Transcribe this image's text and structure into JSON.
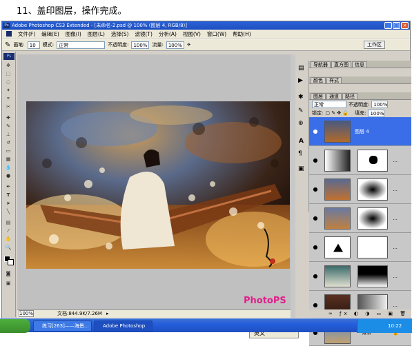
{
  "caption": "11、盖印图层，操作完成。",
  "window": {
    "title": "Adobe Photoshop CS3 Extended - [未命名-2.psd @ 100% (图层 4, RGB/8)]",
    "controls": [
      "_",
      "□",
      "×"
    ]
  },
  "menu": [
    "文件(F)",
    "编辑(E)",
    "图像(I)",
    "图层(L)",
    "选择(S)",
    "滤镜(T)",
    "分析(A)",
    "视图(V)",
    "窗口(W)",
    "帮助(H)"
  ],
  "options": {
    "brush_label": "画笔:",
    "brush_size": "10",
    "mode_label": "模式:",
    "mode_value": "正常",
    "opacity_label": "不透明度:",
    "opacity_value": "100%",
    "flow_label": "流量:",
    "flow_value": "100%",
    "workspace": "工作区"
  },
  "status": {
    "zoom": "100%",
    "doc": "文档:844.9K/7.26M"
  },
  "watermark": "PhotoPS",
  "panels": {
    "top_tabs": [
      "导航器",
      "直方图",
      "信息"
    ],
    "mid_tabs": [
      "颜色",
      "样式"
    ],
    "layer_tabs": [
      "图层",
      "通道",
      "路径"
    ],
    "blend_mode": "正常",
    "opacity_label": "不透明度:",
    "opacity_value": "100%",
    "lock_label": "锁定:",
    "fill_label": "填充:",
    "fill_value": "100%",
    "layer4_name": "图层 4",
    "background_name": "背景"
  },
  "ime": "英文",
  "taskbar": {
    "task1": "练习[263]——海景...",
    "task2": "Adobe Photoshop CS...",
    "clock": "10:22"
  }
}
